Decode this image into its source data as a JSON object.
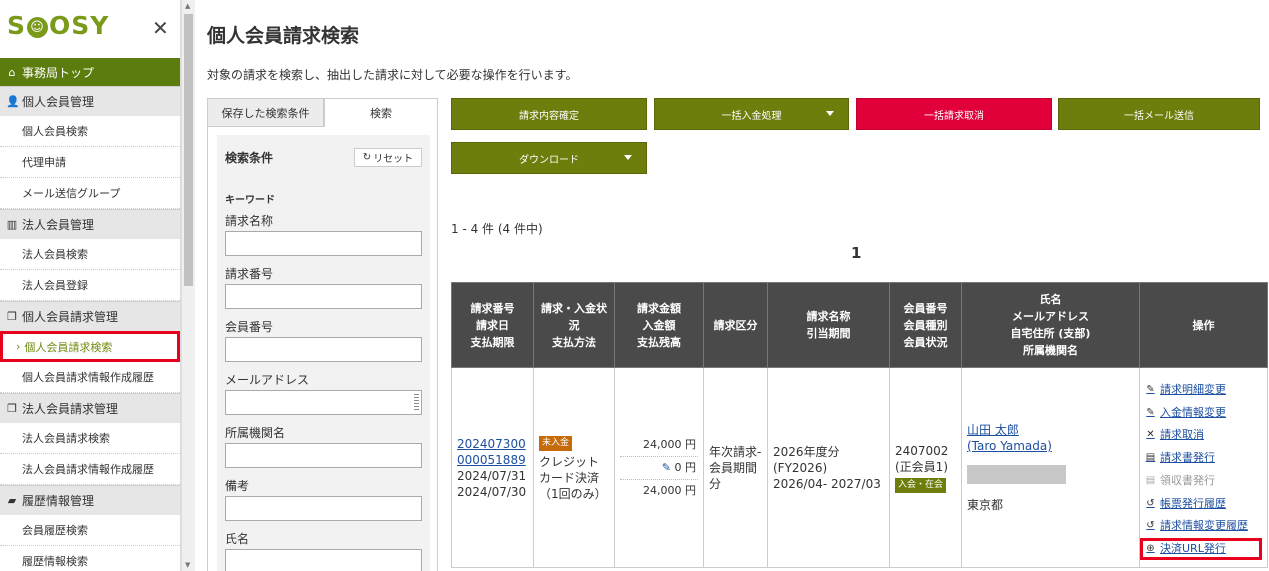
{
  "sidebar": {
    "logo": "SMOOSY",
    "top_item": "事務局トップ",
    "groups": [
      {
        "label": "個人会員管理",
        "items": [
          "個人会員検索",
          "代理申請",
          "メール送信グループ"
        ]
      },
      {
        "label": "法人会員管理",
        "items": [
          "法人会員検索",
          "法人会員登録"
        ]
      },
      {
        "label": "個人会員請求管理",
        "items": [
          "個人会員請求検索",
          "個人会員請求情報作成履歴"
        ]
      },
      {
        "label": "法人会員請求管理",
        "items": [
          "法人会員請求検索",
          "法人会員請求情報作成履歴"
        ]
      },
      {
        "label": "履歴情報管理",
        "items": [
          "会員履歴検索",
          "履歴情報検索"
        ]
      }
    ]
  },
  "page": {
    "title": "個人会員請求検索",
    "description": "対象の請求を検索し、抽出した請求に対して必要な操作を行います。"
  },
  "search_panel": {
    "tab_saved": "保存した検索条件",
    "tab_search": "検索",
    "conditions_title": "検索条件",
    "reset_label": "リセット",
    "keyword_heading": "キーワード",
    "fields": [
      "請求名称",
      "請求番号",
      "会員番号",
      "メールアドレス",
      "所属機関名",
      "備考",
      "氏名"
    ]
  },
  "actions": {
    "confirm": "請求内容確定",
    "bulk_payment": "一括入金処理",
    "bulk_cancel": "一括請求取消",
    "bulk_mail": "一括メール送信",
    "download": "ダウンロード"
  },
  "results": {
    "count_text": "1 - 4 件 (4 件中)",
    "page": "1"
  },
  "table": {
    "headers": [
      "請求番号\n請求日\n支払期限",
      "請求・入金状況\n支払方法",
      "請求金額\n入金額\n支払残高",
      "請求区分",
      "請求名称\n引当期間",
      "会員番号\n会員種別\n会員状況",
      "氏名\nメールアドレス\n自宅住所 (支部)\n所属機関名",
      "操作"
    ],
    "row": {
      "invoice_no": "202407300000051889",
      "invoice_no_line1": "202407300",
      "invoice_no_line2": "000051889",
      "invoice_date": "2024/07/31",
      "due_date": "2024/07/30",
      "status_badge": "未入金",
      "payment_method": "クレジットカード決済（1回のみ）",
      "payment_method_line1": "クレジット",
      "payment_method_line2": "カード決済",
      "payment_method_line3": "（1回のみ）",
      "amount_billed": "24,000 円",
      "amount_paid": "0 円",
      "amount_balance": "24,000 円",
      "category_line1": "年次請求-",
      "category_line2": "会員期間",
      "category_line3": "分",
      "name_line1": "2026年度分",
      "name_line2": "(FY2026)",
      "name_line3": "2026/04- 2027/03",
      "member_no": "2407002",
      "member_type": "(正会員1)",
      "member_status": "入会・在会",
      "member_name": "山田 太郎",
      "member_name_en": "(Taro Yamada)",
      "address": "東京都",
      "operations": [
        "請求明細変更",
        "入金情報変更",
        "請求取消",
        "請求書発行",
        "領収書発行",
        "帳票発行履歴",
        "請求情報変更履歴",
        "決済URL発行"
      ]
    }
  },
  "colors": {
    "brand_green": "#5c7d0e",
    "button_olive": "#6f7d0d",
    "button_red": "#e2003b",
    "highlight_red": "#e8001c",
    "header_dark": "#4a4a4a",
    "badge_orange": "#c76a0a"
  }
}
